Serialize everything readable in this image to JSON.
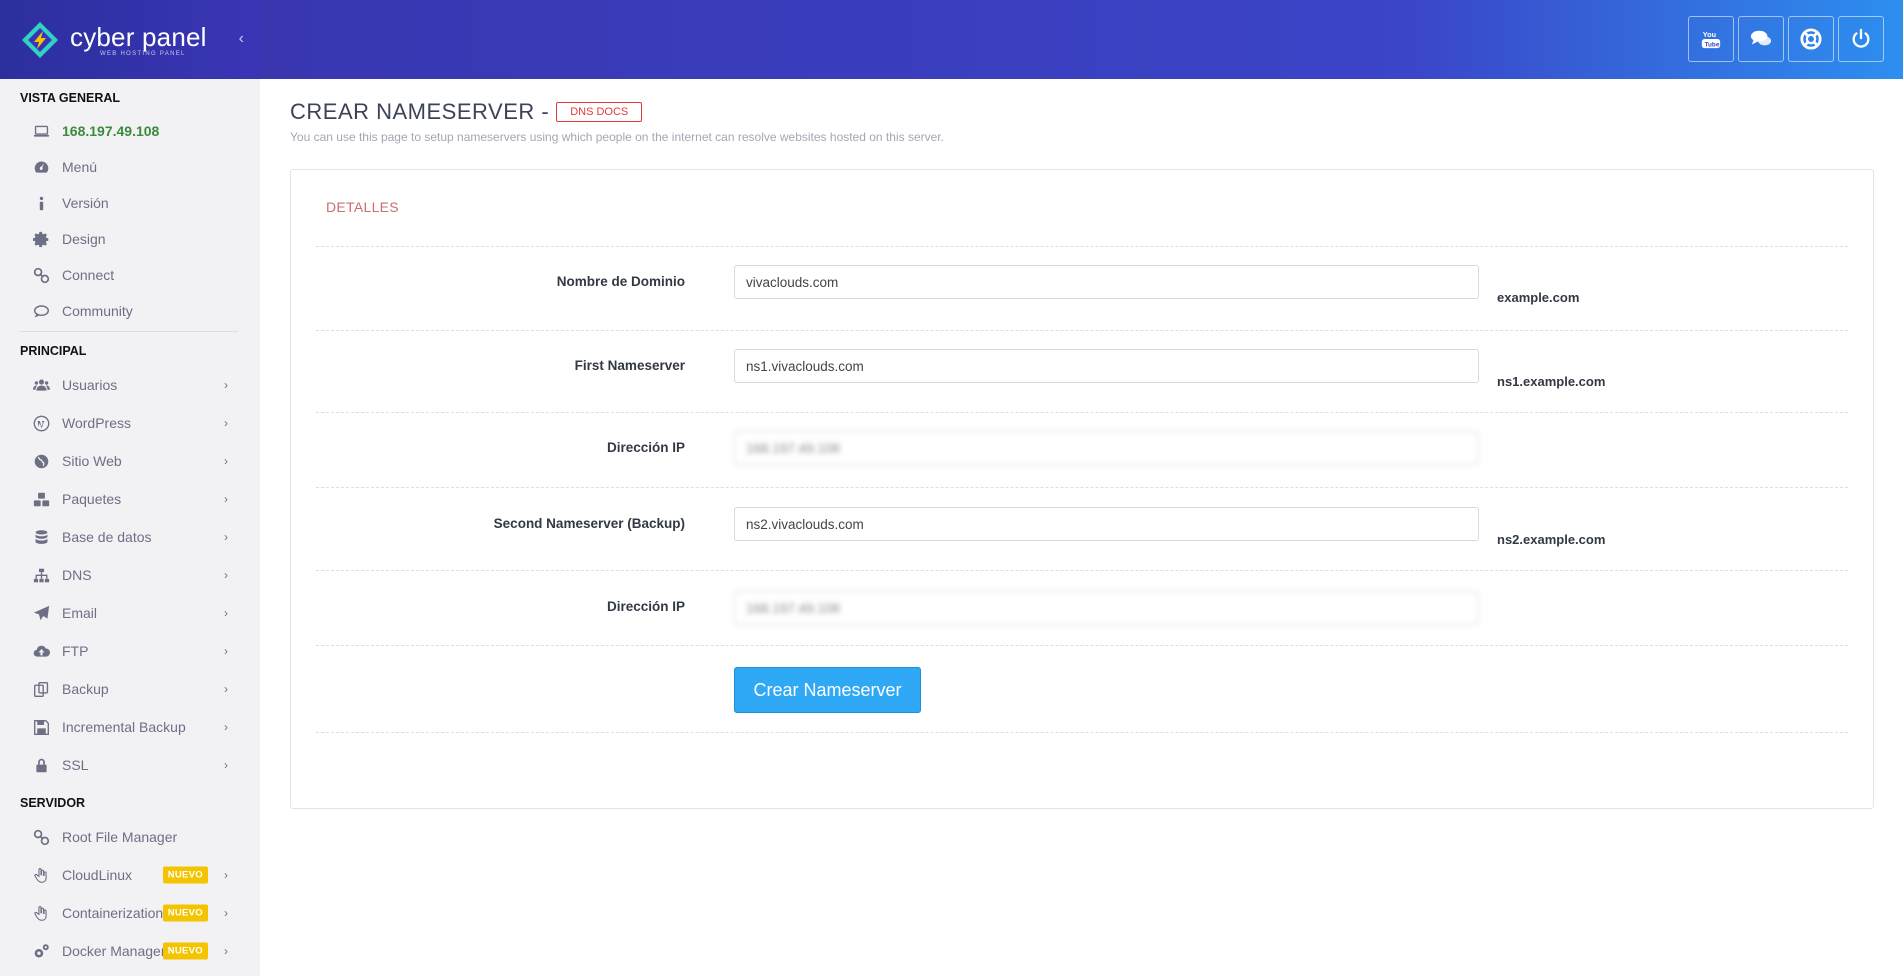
{
  "brand": {
    "name": "cyber panel",
    "tagline": "WEB HOSTING PANEL",
    "collapse_icon": "chevron-left-icon"
  },
  "sidebar": {
    "sections": [
      {
        "title": "VISTA GENERAL",
        "items": [
          {
            "label": "168.197.49.108",
            "icon": "laptop-icon"
          },
          {
            "label": "Menú",
            "icon": "dashboard-icon"
          },
          {
            "label": "Versión",
            "icon": "info-icon"
          },
          {
            "label": "Design",
            "icon": "gear-icon"
          },
          {
            "label": "Connect",
            "icon": "link-icon"
          },
          {
            "label": "Community",
            "icon": "comments-icon"
          }
        ]
      },
      {
        "title": "PRINCIPAL",
        "items": [
          {
            "label": "Usuarios",
            "icon": "users-icon"
          },
          {
            "label": "WordPress",
            "icon": "wordpress-icon"
          },
          {
            "label": "Sitio Web",
            "icon": "globe-icon"
          },
          {
            "label": "Paquetes",
            "icon": "cubes-icon"
          },
          {
            "label": "Base de datos",
            "icon": "database-icon"
          },
          {
            "label": "DNS",
            "icon": "sitemap-icon"
          },
          {
            "label": "Email",
            "icon": "paper-plane-icon"
          },
          {
            "label": "FTP",
            "icon": "cloud-upload-icon"
          },
          {
            "label": "Backup",
            "icon": "copy-icon"
          },
          {
            "label": "Incremental Backup",
            "icon": "save-icon"
          },
          {
            "label": "SSL",
            "icon": "lock-icon"
          }
        ]
      },
      {
        "title": "SERVIDOR",
        "items": [
          {
            "label": "Root File Manager",
            "icon": "link-icon"
          },
          {
            "label": "CloudLinux",
            "icon": "hand-icon",
            "badge": "NUEVO"
          },
          {
            "label": "Containerization",
            "icon": "hand-icon",
            "badge": "NUEVO"
          },
          {
            "label": "Docker Manager",
            "icon": "cogs-icon",
            "badge": "NUEVO"
          }
        ]
      }
    ]
  },
  "header": {
    "buttons": [
      "youtube-icon",
      "chat-icon",
      "support-icon",
      "power-icon"
    ]
  },
  "page": {
    "title": "CREAR NAMESERVER -",
    "docs_link": "DNS DOCS",
    "description": "You can use this page to setup nameservers using which people on the internet can resolve websites hosted on this server."
  },
  "form": {
    "section_title": "DETALLES",
    "fields": [
      {
        "label": "Nombre de Dominio",
        "value": "vivaclouds.com",
        "hint": "example.com"
      },
      {
        "label": "First Nameserver",
        "value": "ns1.vivaclouds.com",
        "hint": "ns1.example.com"
      },
      {
        "label": "Dirección IP",
        "value": "168.197.49.108",
        "hint": ""
      },
      {
        "label": "Second Nameserver (Backup)",
        "value": "ns2.vivaclouds.com",
        "hint": "ns2.example.com"
      },
      {
        "label": "Dirección IP",
        "value": "168.197.49.108",
        "hint": ""
      }
    ],
    "submit_label": "Crear Nameserver"
  },
  "colors": {
    "header_start": "#3936b0",
    "header_end": "#2d8ff0",
    "accent_button": "#2fa8f5",
    "docs_red": "#e23a3a",
    "ip_green": "#3c8a3c",
    "badge_yellow": "#f5c400",
    "section_title": "#cc6d6d"
  }
}
